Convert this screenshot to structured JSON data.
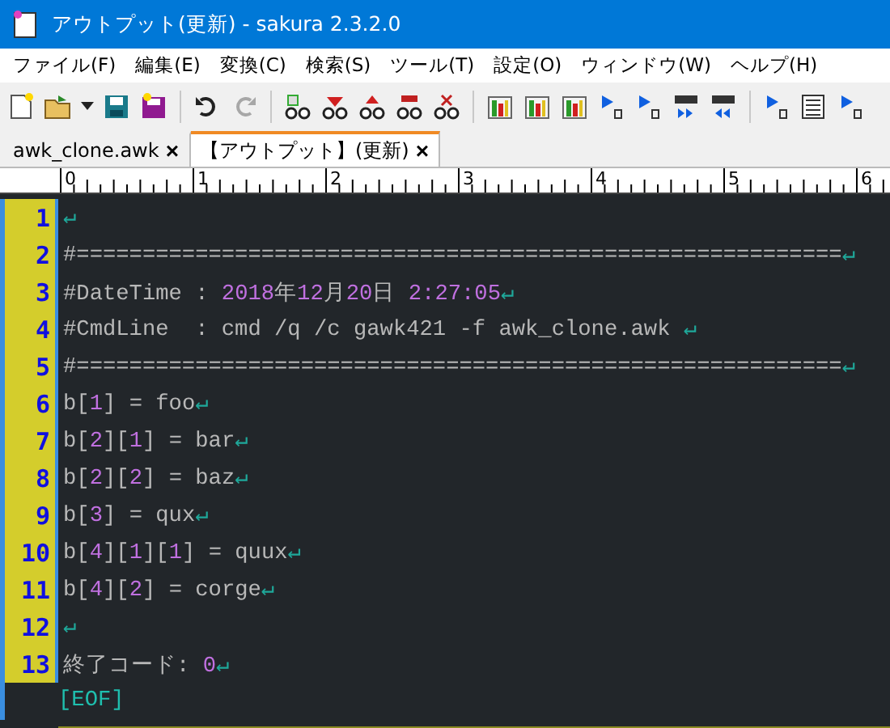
{
  "window": {
    "title": "アウトプット(更新) - sakura 2.3.2.0"
  },
  "menu": [
    "ファイル(F)",
    "編集(E)",
    "変換(C)",
    "検索(S)",
    "ツール(T)",
    "設定(O)",
    "ウィンドウ(W)",
    "ヘルプ(H)"
  ],
  "toolbar": [
    {
      "kind": "new",
      "disabled": false
    },
    {
      "kind": "open",
      "disabled": false
    },
    {
      "kind": "dropdown",
      "disabled": false
    },
    {
      "kind": "save",
      "disabled": false
    },
    {
      "kind": "saveall",
      "disabled": false
    },
    {
      "kind": "sep"
    },
    {
      "kind": "undo",
      "disabled": false
    },
    {
      "kind": "redo",
      "disabled": true
    },
    {
      "kind": "sep"
    },
    {
      "kind": "find",
      "disabled": false
    },
    {
      "kind": "finddown",
      "disabled": false
    },
    {
      "kind": "findup",
      "disabled": false
    },
    {
      "kind": "replace",
      "disabled": false
    },
    {
      "kind": "clearfind",
      "disabled": false
    },
    {
      "kind": "sep"
    },
    {
      "kind": "tool",
      "disabled": false
    },
    {
      "kind": "tool",
      "disabled": false
    },
    {
      "kind": "tool",
      "disabled": false
    },
    {
      "kind": "macro",
      "disabled": false
    },
    {
      "kind": "macro",
      "disabled": false
    },
    {
      "kind": "tabnext",
      "disabled": false
    },
    {
      "kind": "tabprev",
      "disabled": false
    },
    {
      "kind": "sep"
    },
    {
      "kind": "macro",
      "disabled": false
    },
    {
      "kind": "list",
      "disabled": false
    },
    {
      "kind": "macro",
      "disabled": false
    }
  ],
  "tabs": [
    {
      "label": "awk_clone.awk",
      "close": "×",
      "selected": false
    },
    {
      "label": "【アウトプット】(更新)",
      "close": "×",
      "selected": true
    }
  ],
  "ruler": [
    "0",
    "1",
    "2",
    "3",
    "4",
    "5",
    "6"
  ],
  "lines": [
    {
      "number": "1",
      "segments": [
        {
          "kind": "eol",
          "text": "↵"
        }
      ]
    },
    {
      "number": "2",
      "segments": [
        {
          "kind": "text",
          "text": "#=========================================================="
        },
        {
          "kind": "eol",
          "text": "↵"
        }
      ]
    },
    {
      "number": "3",
      "segments": [
        {
          "kind": "text",
          "text": "#DateTime : "
        },
        {
          "kind": "num",
          "text": "2018"
        },
        {
          "kind": "text",
          "text": "年"
        },
        {
          "kind": "num",
          "text": "12"
        },
        {
          "kind": "text",
          "text": "月"
        },
        {
          "kind": "num",
          "text": "20"
        },
        {
          "kind": "text",
          "text": "日 "
        },
        {
          "kind": "num",
          "text": "2:27:05"
        },
        {
          "kind": "eol",
          "text": "↵"
        }
      ]
    },
    {
      "number": "4",
      "segments": [
        {
          "kind": "text",
          "text": "#CmdLine  : cmd /q /c gawk421 -f awk_clone.awk "
        },
        {
          "kind": "eol",
          "text": "↵"
        }
      ]
    },
    {
      "number": "5",
      "segments": [
        {
          "kind": "text",
          "text": "#=========================================================="
        },
        {
          "kind": "eol",
          "text": "↵"
        }
      ]
    },
    {
      "number": "6",
      "segments": [
        {
          "kind": "text",
          "text": "b["
        },
        {
          "kind": "num",
          "text": "1"
        },
        {
          "kind": "text",
          "text": "] = foo"
        },
        {
          "kind": "eol",
          "text": "↵"
        }
      ]
    },
    {
      "number": "7",
      "segments": [
        {
          "kind": "text",
          "text": "b["
        },
        {
          "kind": "num",
          "text": "2"
        },
        {
          "kind": "text",
          "text": "]["
        },
        {
          "kind": "num",
          "text": "1"
        },
        {
          "kind": "text",
          "text": "] = bar"
        },
        {
          "kind": "eol",
          "text": "↵"
        }
      ]
    },
    {
      "number": "8",
      "segments": [
        {
          "kind": "text",
          "text": "b["
        },
        {
          "kind": "num",
          "text": "2"
        },
        {
          "kind": "text",
          "text": "]["
        },
        {
          "kind": "num",
          "text": "2"
        },
        {
          "kind": "text",
          "text": "] = baz"
        },
        {
          "kind": "eol",
          "text": "↵"
        }
      ]
    },
    {
      "number": "9",
      "segments": [
        {
          "kind": "text",
          "text": "b["
        },
        {
          "kind": "num",
          "text": "3"
        },
        {
          "kind": "text",
          "text": "] = qux"
        },
        {
          "kind": "eol",
          "text": "↵"
        }
      ]
    },
    {
      "number": "10",
      "segments": [
        {
          "kind": "text",
          "text": "b["
        },
        {
          "kind": "num",
          "text": "4"
        },
        {
          "kind": "text",
          "text": "]["
        },
        {
          "kind": "num",
          "text": "1"
        },
        {
          "kind": "text",
          "text": "]["
        },
        {
          "kind": "num",
          "text": "1"
        },
        {
          "kind": "text",
          "text": "] = quux"
        },
        {
          "kind": "eol",
          "text": "↵"
        }
      ]
    },
    {
      "number": "11",
      "segments": [
        {
          "kind": "text",
          "text": "b["
        },
        {
          "kind": "num",
          "text": "4"
        },
        {
          "kind": "text",
          "text": "]["
        },
        {
          "kind": "num",
          "text": "2"
        },
        {
          "kind": "text",
          "text": "] = corge"
        },
        {
          "kind": "eol",
          "text": "↵"
        }
      ]
    },
    {
      "number": "12",
      "segments": [
        {
          "kind": "eol",
          "text": "↵"
        }
      ]
    },
    {
      "number": "13",
      "segments": [
        {
          "kind": "text",
          "text": "終了コード: "
        },
        {
          "kind": "num",
          "text": "0"
        },
        {
          "kind": "eol",
          "text": "↵"
        }
      ]
    }
  ],
  "eof": "[EOF]"
}
